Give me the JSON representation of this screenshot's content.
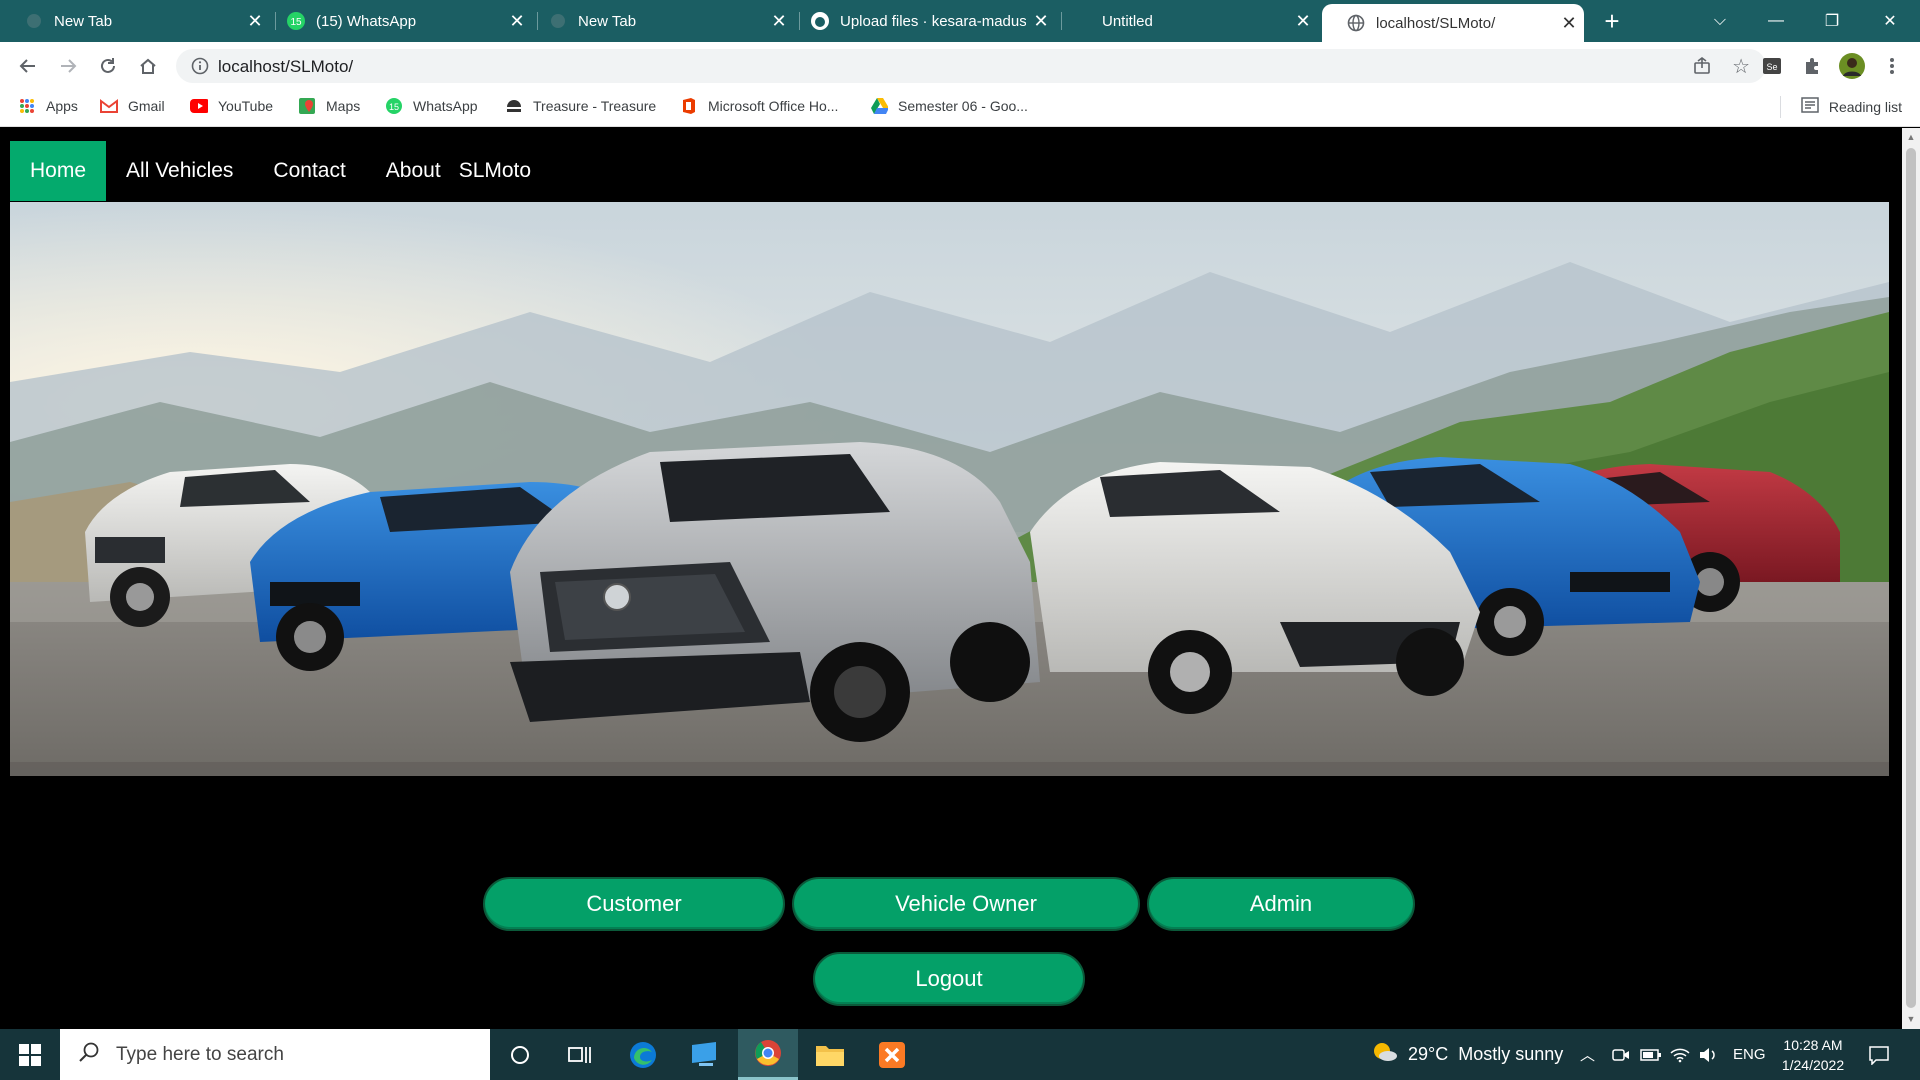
{
  "browser": {
    "tabs": [
      {
        "label": "New Tab",
        "icon": "newtab-favicon"
      },
      {
        "label": "(15) WhatsApp",
        "icon": "whatsapp-favicon"
      },
      {
        "label": "New Tab",
        "icon": "newtab-favicon"
      },
      {
        "label": "Upload files · kesara-madus",
        "icon": "github-favicon"
      },
      {
        "label": "Untitled",
        "icon": "none"
      },
      {
        "label": "localhost/SLMoto/",
        "icon": "globe-favicon",
        "active": true
      }
    ],
    "address": "localhost/SLMoto/",
    "bookmarks": [
      {
        "label": "Apps",
        "icon": "apps-grid-icon"
      },
      {
        "label": "Gmail",
        "icon": "gmail-icon"
      },
      {
        "label": "YouTube",
        "icon": "youtube-icon"
      },
      {
        "label": "Maps",
        "icon": "maps-icon"
      },
      {
        "label": "WhatsApp",
        "icon": "whatsapp-icon"
      },
      {
        "label": "Treasure - Treasure",
        "icon": "treasure-icon"
      },
      {
        "label": "Microsoft Office Ho...",
        "icon": "office-icon"
      },
      {
        "label": "Semester 06 - Goo...",
        "icon": "drive-icon"
      }
    ],
    "reading_list": "Reading list"
  },
  "site": {
    "nav": [
      {
        "label": "Home",
        "active": true
      },
      {
        "label": "All Vehicles"
      },
      {
        "label": "Contact"
      },
      {
        "label": "About"
      }
    ],
    "brand": "SLMoto",
    "buttons": {
      "customer": "Customer",
      "vehicle_owner": "Vehicle Owner",
      "admin": "Admin",
      "logout": "Logout"
    },
    "accent": "#04aa6d"
  },
  "taskbar": {
    "search_placeholder": "Type here to search",
    "weather": "29°C  Mostly sunny",
    "lang": "ENG",
    "time": "10:28 AM",
    "date": "1/24/2022"
  }
}
